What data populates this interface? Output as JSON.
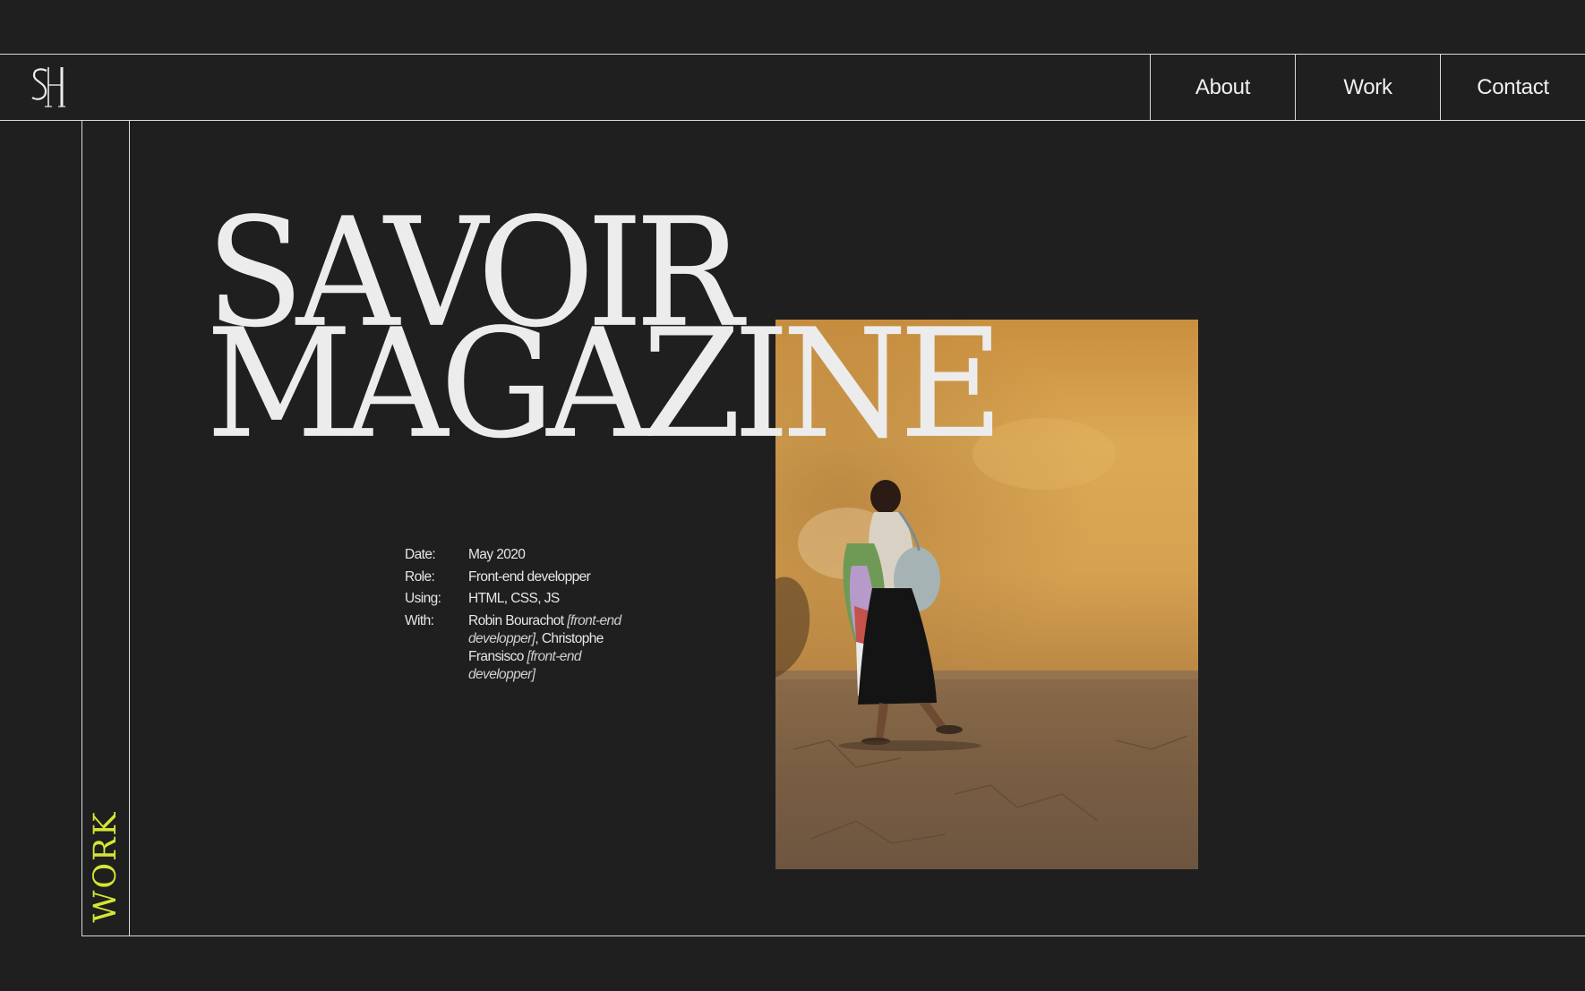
{
  "header": {
    "logo_text": "SH",
    "nav": [
      {
        "label": "About"
      },
      {
        "label": "Work"
      },
      {
        "label": "Contact"
      }
    ]
  },
  "section": {
    "label": "WORK",
    "accent_color": "#d5e534"
  },
  "project": {
    "title_line_1": "SAVOIR",
    "title_line_2": "MAGAZINE",
    "details": {
      "date_label": "Date:",
      "date_value": "May 2020",
      "role_label": "Role:",
      "role_value": "Front-end developper",
      "using_label": "Using:",
      "using_value": "HTML, CSS, JS",
      "with_label": "With:",
      "collaborator_1_name": "Robin Bourachot",
      "collaborator_1_role": "[front-end developper]",
      "separator": ",",
      "collaborator_2_name": "Christophe Fransisco",
      "collaborator_2_role": "[front-end developper]"
    }
  },
  "colors": {
    "background": "#1f1f1f",
    "text": "#ededed",
    "lines": "#d9d9d9",
    "photo_wall": "#d9a74f",
    "photo_ground": "#7a6248"
  }
}
